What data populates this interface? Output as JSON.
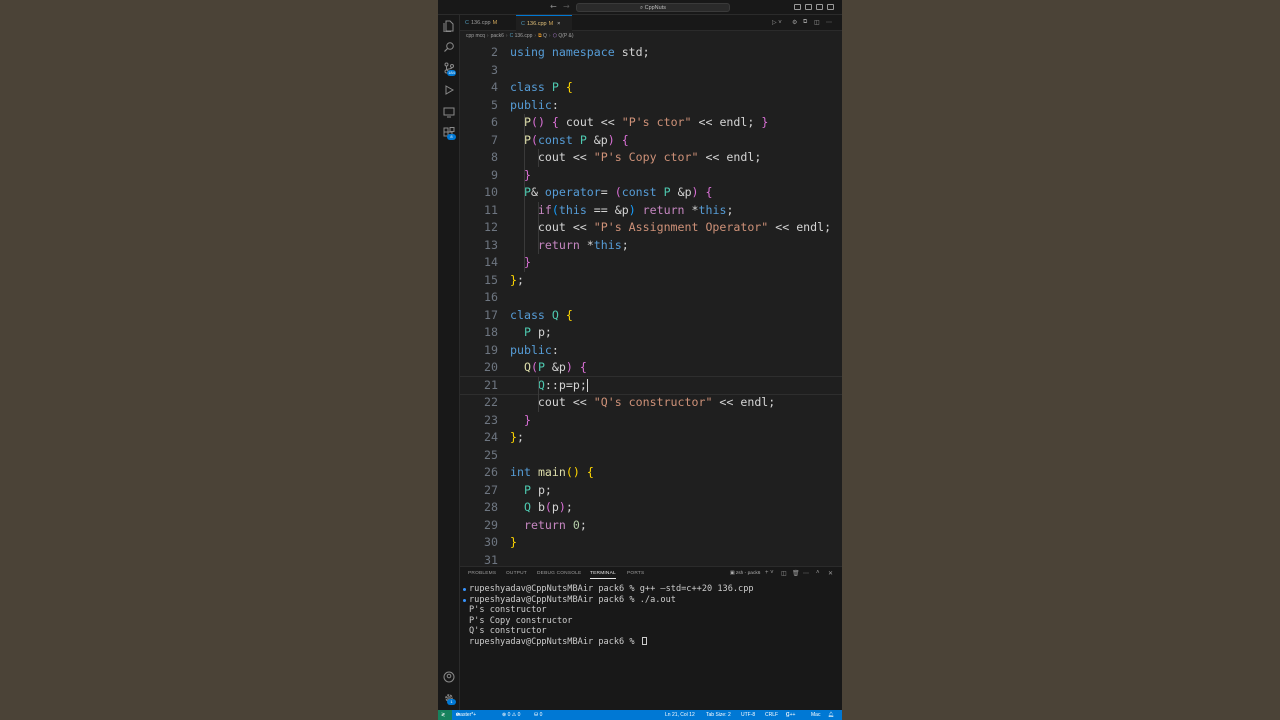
{
  "window": {
    "title": "CppNuts"
  },
  "tabs": [
    {
      "label": "136.cpp",
      "modified": "M",
      "active": false
    },
    {
      "label": "136.cpp",
      "modified": "M",
      "active": true,
      "close": "×"
    }
  ],
  "breadcrumb": [
    "cpp mcq",
    "pack6",
    "136.cpp",
    "Q",
    "Q(P &)"
  ],
  "activity_badges": {
    "source_control": "184",
    "extensions": "8",
    "accounts": "1"
  },
  "editor": {
    "lines": [
      {
        "n": "2",
        "text": "using namespace std;"
      },
      {
        "n": "3",
        "text": ""
      },
      {
        "n": "4",
        "text": "class P {"
      },
      {
        "n": "5",
        "text": "public:"
      },
      {
        "n": "6",
        "text": "  P() { cout << \"P's ctor\" << endl; }"
      },
      {
        "n": "7",
        "text": "  P(const P &p) {"
      },
      {
        "n": "8",
        "text": "    cout << \"P's Copy ctor\" << endl;"
      },
      {
        "n": "9",
        "text": "  }"
      },
      {
        "n": "10",
        "text": "  P& operator= (const P &p) {"
      },
      {
        "n": "11",
        "text": "    if(this == &p) return *this;"
      },
      {
        "n": "12",
        "text": "    cout << \"P's Assignment Operator\" << endl;"
      },
      {
        "n": "13",
        "text": "    return *this;"
      },
      {
        "n": "14",
        "text": "  }"
      },
      {
        "n": "15",
        "text": "};"
      },
      {
        "n": "16",
        "text": ""
      },
      {
        "n": "17",
        "text": "class Q {"
      },
      {
        "n": "18",
        "text": "  P p;"
      },
      {
        "n": "19",
        "text": "public:"
      },
      {
        "n": "20",
        "text": "  Q(P &p) {"
      },
      {
        "n": "21",
        "text": "    Q::p=p;"
      },
      {
        "n": "22",
        "text": "    cout << \"Q's constructor\" << endl;"
      },
      {
        "n": "23",
        "text": "  }"
      },
      {
        "n": "24",
        "text": "};"
      },
      {
        "n": "25",
        "text": ""
      },
      {
        "n": "26",
        "text": "int main() {"
      },
      {
        "n": "27",
        "text": "  P p;"
      },
      {
        "n": "28",
        "text": "  Q b(p);"
      },
      {
        "n": "29",
        "text": "  return 0;"
      },
      {
        "n": "30",
        "text": "}"
      },
      {
        "n": "31",
        "text": ""
      }
    ]
  },
  "panel": {
    "tabs": [
      "PROBLEMS",
      "OUTPUT",
      "DEBUG CONSOLE",
      "TERMINAL",
      "PORTS"
    ],
    "active_tab": "TERMINAL",
    "shell_label": "zsh - pack6",
    "terminal_lines": [
      {
        "text": "rupeshyadav@CppNutsMBAir pack6 % g++ —std=c++20 136.cpp",
        "dot": true
      },
      {
        "text": "rupeshyadav@CppNutsMBAir pack6 % ./a.out",
        "dot": true
      },
      {
        "text": "P's constructor",
        "dot": false
      },
      {
        "text": "P's Copy constructor",
        "dot": false
      },
      {
        "text": "Q's constructor",
        "dot": false
      },
      {
        "text": "rupeshyadav@CppNutsMBAir pack6 % ",
        "dot": false
      }
    ]
  },
  "statusbar": {
    "branch": "master*+",
    "problems": "⊗ 0 ⚠ 0",
    "ports": "⛁ 0",
    "position": "Ln 21, Col 12",
    "tab_size": "Tab Size: 2",
    "encoding": "UTF-8",
    "eol": "CRLF",
    "language": "C++",
    "platform": "Mac"
  },
  "colors": {
    "background": "#4b4337",
    "editor_bg": "#1f1f1f",
    "accent": "#0078d4",
    "keyword": "#569cd6",
    "string": "#ce9178"
  }
}
